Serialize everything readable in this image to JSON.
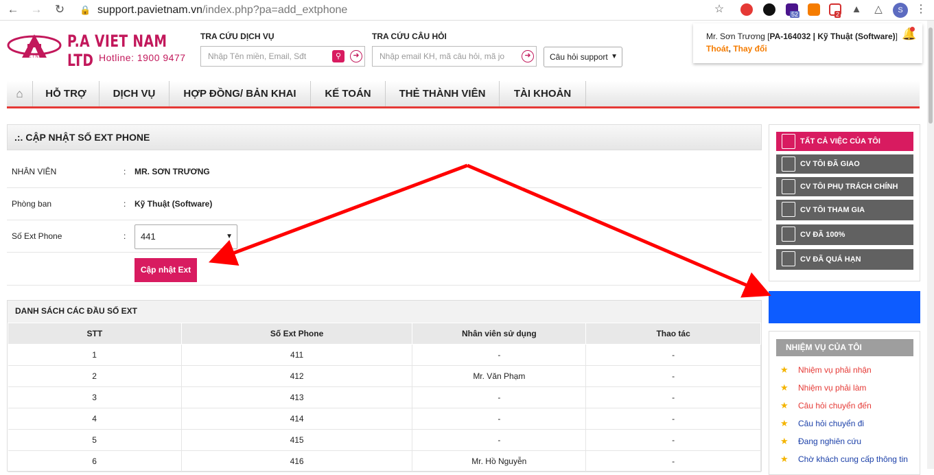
{
  "browser": {
    "url_host": "support.pavietnam.vn",
    "url_path": "/index.php?pa=add_extphone",
    "ext_badge_1": "52",
    "ext_badge_2": "2",
    "profile_initial": "S"
  },
  "header": {
    "logo_text": "P.A VIET NAM LTD",
    "logo_sub": "VIETNAM",
    "hotline": "Hotline: 1900 9477",
    "service_search_title": "TRA CỨU DỊCH VỤ",
    "service_search_placeholder": "Nhập Tên miền, Email, Sđt",
    "faq_search_title": "TRA CỨU CÂU HỎI",
    "faq_search_placeholder": "Nhập email KH, mã câu hỏi, mã jo",
    "faq_select": "Câu hỏi support"
  },
  "user": {
    "name_prefix": "Mr. Sơn Trương [",
    "name_bold": "PA-164032 | Kỹ Thuật (Software)",
    "name_suffix": "]",
    "logout": "Thoát",
    "sep": ", ",
    "change": "Thay đổi"
  },
  "menu": [
    "HỖ TRỢ",
    "DỊCH VỤ",
    "HỢP ĐỒNG/ BẢN KHAI",
    "KẾ TOÁN",
    "THẺ THÀNH VIÊN",
    "TÀI KHOẢN"
  ],
  "update_form": {
    "title": ".:. CẬP NHẬT SỐ EXT PHONE",
    "staff_label": "NHÂN VIÊN",
    "staff_value": "MR. SƠN TRƯƠNG",
    "dept_label": "Phòng ban",
    "dept_value": "Kỹ Thuật (Software)",
    "ext_label": "Số Ext Phone",
    "ext_value": "441",
    "colon": ":",
    "submit": "Cập nhật Ext"
  },
  "ext_list": {
    "title": "DANH SÁCH CÁC ĐẦU SỐ EXT",
    "headers": [
      "STT",
      "Số Ext Phone",
      "Nhân viên sử dụng",
      "Thao tác"
    ],
    "rows": [
      [
        "1",
        "411",
        "-",
        "-"
      ],
      [
        "2",
        "412",
        "Mr. Văn Phạm",
        "-"
      ],
      [
        "3",
        "413",
        "-",
        "-"
      ],
      [
        "4",
        "414",
        "-",
        "-"
      ],
      [
        "5",
        "415",
        "-",
        "-"
      ],
      [
        "6",
        "416",
        "Mr. Hồ Nguyễn",
        "-"
      ]
    ]
  },
  "sidebar": {
    "work_buttons": [
      "TẤT CẢ VIỆC CỦA TÔI",
      "CV TÔI ĐÃ GIAO",
      "CV TÔI PHỤ TRÁCH CHÍNH",
      "CV TÔI THAM GIA",
      "CV ĐÃ 100%",
      "CV ĐÃ QUÁ HẠN"
    ],
    "tasks_title": "NHIỆM VỤ CỦA TÔI",
    "tasks": [
      "Nhiệm vụ phải nhận",
      "Nhiệm vụ phải làm",
      "Câu hỏi chuyển đến",
      "Câu hỏi chuyển đi",
      "Đang nghiên cứu",
      "Chờ khách cung cấp thông tin"
    ]
  },
  "colors": {
    "accent": "#d81b60",
    "menu_underline": "#e53935",
    "sidebar_button": "#616161",
    "highlight_box": "#0d5cff",
    "arrow": "#ff0000",
    "link_red": "#e53935",
    "link_blue": "#1a3fa8"
  }
}
